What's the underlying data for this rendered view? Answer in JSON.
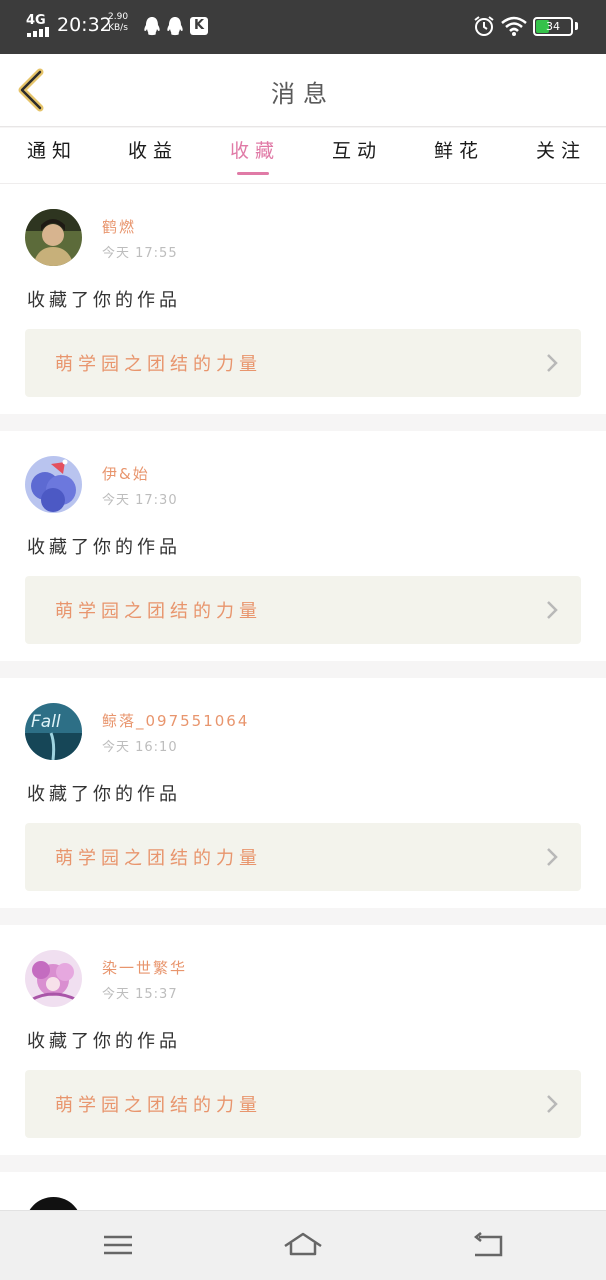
{
  "status_bar": {
    "network": "4G",
    "time": "20:32",
    "speed_value": "2.90",
    "speed_unit": "KB/s",
    "battery": "34"
  },
  "header": {
    "title": "消息",
    "back_icon": "chevron-left-icon"
  },
  "tabs": [
    {
      "label": "通知",
      "active": false
    },
    {
      "label": "收益",
      "active": false
    },
    {
      "label": "收藏",
      "active": true
    },
    {
      "label": "互动",
      "active": false
    },
    {
      "label": "鲜花",
      "active": false
    },
    {
      "label": "关注",
      "active": false
    }
  ],
  "colors": {
    "accent": "#e07aa6",
    "name": "#e8956d",
    "card_bg": "#f3f3ec"
  },
  "messages": [
    {
      "username": "鹤燃",
      "time": "今天 17:55",
      "action": "收藏了你的作品",
      "work_title": "萌学园之团结的力量"
    },
    {
      "username": "伊&始",
      "time": "今天 17:30",
      "action": "收藏了你的作品",
      "work_title": "萌学园之团结的力量"
    },
    {
      "username": "鲸落_097551064",
      "time": "今天 16:10",
      "action": "收藏了你的作品",
      "work_title": "萌学园之团结的力量"
    },
    {
      "username": "染一世繁华",
      "time": "今天 15:37",
      "action": "收藏了你的作品",
      "work_title": "萌学园之团结的力量"
    }
  ],
  "navbar": {
    "menu_icon": "menu-icon",
    "home_icon": "home-icon",
    "back_icon": "back-icon"
  }
}
